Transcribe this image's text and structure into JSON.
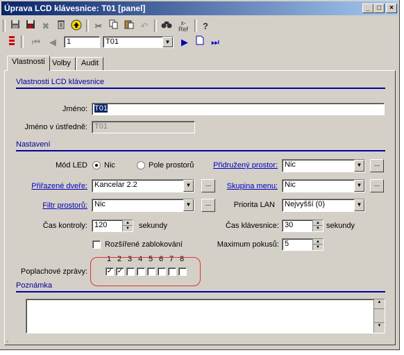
{
  "window": {
    "title": "Úprava LCD klávesnice: T01 [panel]"
  },
  "nav": {
    "record_number": "1",
    "record_select": "T01"
  },
  "tabs": [
    "Vlastnosti",
    "Volby",
    "Audit"
  ],
  "sections": {
    "properties": "Vlastnosti LCD klávesnice",
    "settings": "Nastavení",
    "note": "Poznámka"
  },
  "fields": {
    "name_label": "Jméno:",
    "name_value": "T01",
    "panel_name_label": "Jméno v ústředně:",
    "panel_name_value": "T01",
    "led_mode_label": "Mód LED",
    "led_option_none": "Nic",
    "led_option_areas": "Pole prostorů",
    "assoc_area_label": "Přidružený prostor:",
    "assoc_area_value": "Nic",
    "doors_label": "Přiřazené dveře:",
    "doors_value": "Kancelar 2.2",
    "menu_group_label": "Skupina menu:",
    "menu_group_value": "Nic",
    "area_filter_label": "Filtr prostorů:",
    "area_filter_value": "Nic",
    "lan_priority_label": "Priorita LAN",
    "lan_priority_value": "Nejvyšší (0)",
    "check_time_label": "Čas kontroly:",
    "check_time_value": "120",
    "check_time_unit": "sekundy",
    "key_time_label": "Čas klávesnice:",
    "key_time_value": "30",
    "key_time_unit": "sekundy",
    "extended_lock_label": "Rozšířené zablokování",
    "max_attempts_label": "Maximum pokusů:",
    "max_attempts_value": "5",
    "alarm_msgs_label": "Poplachové zprávy:"
  },
  "alarm_messages": {
    "numbers": [
      "1",
      "2",
      "3",
      "4",
      "5",
      "6",
      "7",
      "8"
    ],
    "checked": [
      true,
      true,
      false,
      false,
      false,
      false,
      false,
      false
    ]
  },
  "note_text": "",
  "colors": {
    "title_start": "#0a246a",
    "section": "#0000a0",
    "link_label": "#0000c0",
    "highlight": "#e03030"
  }
}
